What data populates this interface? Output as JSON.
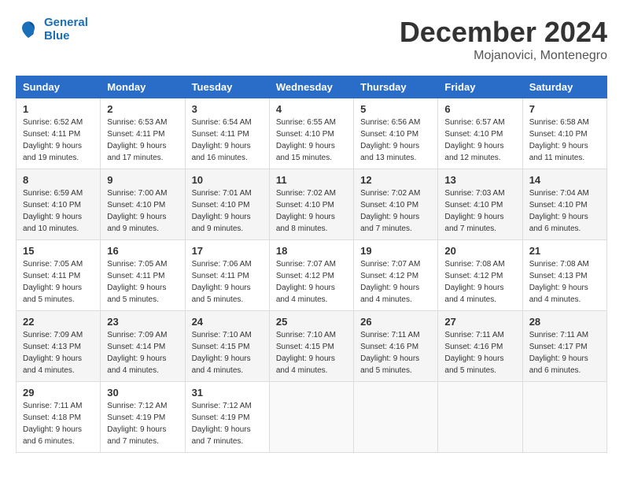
{
  "header": {
    "logo": {
      "line1": "General",
      "line2": "Blue"
    },
    "title": "December 2024",
    "subtitle": "Mojanovici, Montenegro"
  },
  "weekdays": [
    "Sunday",
    "Monday",
    "Tuesday",
    "Wednesday",
    "Thursday",
    "Friday",
    "Saturday"
  ],
  "weeks": [
    [
      {
        "day": "1",
        "sunrise": "6:52 AM",
        "sunset": "4:11 PM",
        "daylight": "9 hours and 19 minutes."
      },
      {
        "day": "2",
        "sunrise": "6:53 AM",
        "sunset": "4:11 PM",
        "daylight": "9 hours and 17 minutes."
      },
      {
        "day": "3",
        "sunrise": "6:54 AM",
        "sunset": "4:11 PM",
        "daylight": "9 hours and 16 minutes."
      },
      {
        "day": "4",
        "sunrise": "6:55 AM",
        "sunset": "4:10 PM",
        "daylight": "9 hours and 15 minutes."
      },
      {
        "day": "5",
        "sunrise": "6:56 AM",
        "sunset": "4:10 PM",
        "daylight": "9 hours and 13 minutes."
      },
      {
        "day": "6",
        "sunrise": "6:57 AM",
        "sunset": "4:10 PM",
        "daylight": "9 hours and 12 minutes."
      },
      {
        "day": "7",
        "sunrise": "6:58 AM",
        "sunset": "4:10 PM",
        "daylight": "9 hours and 11 minutes."
      }
    ],
    [
      {
        "day": "8",
        "sunrise": "6:59 AM",
        "sunset": "4:10 PM",
        "daylight": "9 hours and 10 minutes."
      },
      {
        "day": "9",
        "sunrise": "7:00 AM",
        "sunset": "4:10 PM",
        "daylight": "9 hours and 9 minutes."
      },
      {
        "day": "10",
        "sunrise": "7:01 AM",
        "sunset": "4:10 PM",
        "daylight": "9 hours and 9 minutes."
      },
      {
        "day": "11",
        "sunrise": "7:02 AM",
        "sunset": "4:10 PM",
        "daylight": "9 hours and 8 minutes."
      },
      {
        "day": "12",
        "sunrise": "7:02 AM",
        "sunset": "4:10 PM",
        "daylight": "9 hours and 7 minutes."
      },
      {
        "day": "13",
        "sunrise": "7:03 AM",
        "sunset": "4:10 PM",
        "daylight": "9 hours and 7 minutes."
      },
      {
        "day": "14",
        "sunrise": "7:04 AM",
        "sunset": "4:10 PM",
        "daylight": "9 hours and 6 minutes."
      }
    ],
    [
      {
        "day": "15",
        "sunrise": "7:05 AM",
        "sunset": "4:11 PM",
        "daylight": "9 hours and 5 minutes."
      },
      {
        "day": "16",
        "sunrise": "7:05 AM",
        "sunset": "4:11 PM",
        "daylight": "9 hours and 5 minutes."
      },
      {
        "day": "17",
        "sunrise": "7:06 AM",
        "sunset": "4:11 PM",
        "daylight": "9 hours and 5 minutes."
      },
      {
        "day": "18",
        "sunrise": "7:07 AM",
        "sunset": "4:12 PM",
        "daylight": "9 hours and 4 minutes."
      },
      {
        "day": "19",
        "sunrise": "7:07 AM",
        "sunset": "4:12 PM",
        "daylight": "9 hours and 4 minutes."
      },
      {
        "day": "20",
        "sunrise": "7:08 AM",
        "sunset": "4:12 PM",
        "daylight": "9 hours and 4 minutes."
      },
      {
        "day": "21",
        "sunrise": "7:08 AM",
        "sunset": "4:13 PM",
        "daylight": "9 hours and 4 minutes."
      }
    ],
    [
      {
        "day": "22",
        "sunrise": "7:09 AM",
        "sunset": "4:13 PM",
        "daylight": "9 hours and 4 minutes."
      },
      {
        "day": "23",
        "sunrise": "7:09 AM",
        "sunset": "4:14 PM",
        "daylight": "9 hours and 4 minutes."
      },
      {
        "day": "24",
        "sunrise": "7:10 AM",
        "sunset": "4:15 PM",
        "daylight": "9 hours and 4 minutes."
      },
      {
        "day": "25",
        "sunrise": "7:10 AM",
        "sunset": "4:15 PM",
        "daylight": "9 hours and 4 minutes."
      },
      {
        "day": "26",
        "sunrise": "7:11 AM",
        "sunset": "4:16 PM",
        "daylight": "9 hours and 5 minutes."
      },
      {
        "day": "27",
        "sunrise": "7:11 AM",
        "sunset": "4:16 PM",
        "daylight": "9 hours and 5 minutes."
      },
      {
        "day": "28",
        "sunrise": "7:11 AM",
        "sunset": "4:17 PM",
        "daylight": "9 hours and 6 minutes."
      }
    ],
    [
      {
        "day": "29",
        "sunrise": "7:11 AM",
        "sunset": "4:18 PM",
        "daylight": "9 hours and 6 minutes."
      },
      {
        "day": "30",
        "sunrise": "7:12 AM",
        "sunset": "4:19 PM",
        "daylight": "9 hours and 7 minutes."
      },
      {
        "day": "31",
        "sunrise": "7:12 AM",
        "sunset": "4:19 PM",
        "daylight": "9 hours and 7 minutes."
      },
      null,
      null,
      null,
      null
    ]
  ]
}
